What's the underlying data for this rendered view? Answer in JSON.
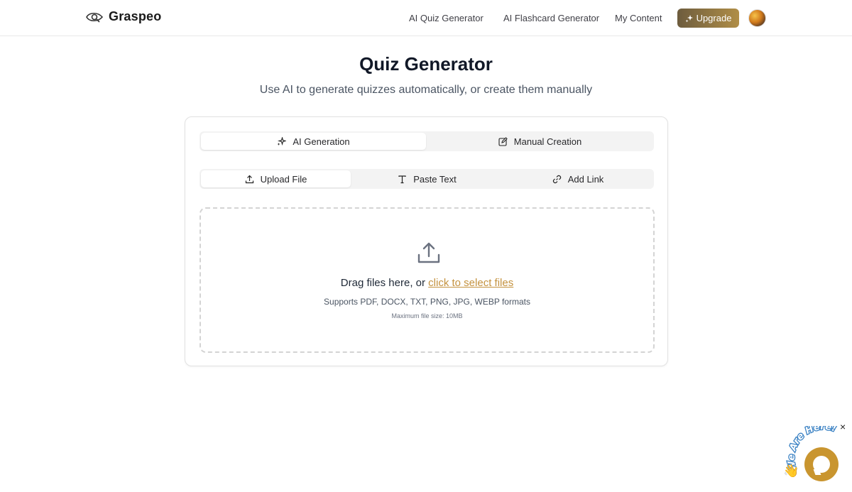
{
  "header": {
    "brand": "Graspeo",
    "nav": [
      {
        "label": "AI Quiz Generator"
      },
      {
        "label": "AI Flashcard Generator"
      },
      {
        "label": "My Content"
      }
    ],
    "upgrade_label": "Upgrade",
    "accent_gradient": [
      "#6d5c3e",
      "#b08e47"
    ]
  },
  "page": {
    "title": "Quiz Generator",
    "subtitle": "Use AI to generate quizzes automatically, or create them manually"
  },
  "mode_tabs": [
    {
      "label": "AI Generation",
      "icon": "sparkles-icon",
      "active": true
    },
    {
      "label": "Manual Creation",
      "icon": "edit-icon",
      "active": false
    }
  ],
  "source_tabs": [
    {
      "label": "Upload File",
      "icon": "upload-icon",
      "active": true
    },
    {
      "label": "Paste Text",
      "icon": "text-icon",
      "active": false
    },
    {
      "label": "Add Link",
      "icon": "link-icon",
      "active": false
    }
  ],
  "dropzone": {
    "prompt": "Drag files here, or ",
    "link": "click to select files",
    "formats": "Supports PDF, DOCX, TXT, PNG, JPG, WEBP formats",
    "max_size": "Maximum file size: 10MB",
    "link_color": "#c4923f"
  },
  "chat_widget": {
    "badge_text": "We Are Here!",
    "close_label": "×",
    "color": "#c9952f"
  }
}
